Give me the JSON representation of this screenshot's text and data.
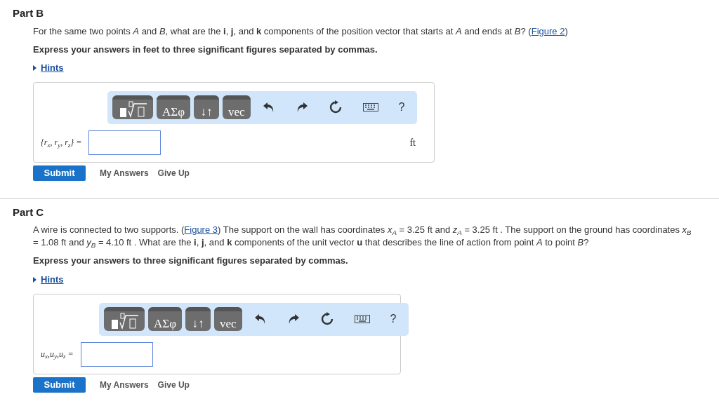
{
  "parts": [
    {
      "title": "Part B",
      "question": [
        {
          "kind": "text",
          "text": "For the same two points *A* and *B*, what are the **i**, **j**, and **k** components of the position vector that starts at *A* and ends at *B*? ("
        },
        {
          "kind": "link",
          "text": "Figure 2"
        },
        {
          "kind": "text",
          "text": ")"
        }
      ],
      "instruction": "Express your answers in feet to three significant figures separated by commas.",
      "hints": "Hints",
      "answer": {
        "label": "{*r*$_{x}$, *r*$_{y}$, *r*$_{z}$} =",
        "unit": "ft",
        "toolbar": [
          {
            "kind": "template"
          },
          {
            "kind": "text",
            "label": "ΑΣφ"
          },
          {
            "kind": "text",
            "label": "↓↑"
          },
          {
            "kind": "text",
            "label": "vec"
          },
          {
            "kind": "undo"
          },
          {
            "kind": "redo"
          },
          {
            "kind": "reset"
          },
          {
            "kind": "keyboard"
          },
          {
            "kind": "help",
            "label": "?"
          }
        ]
      },
      "buttons": [
        {
          "kind": "primary",
          "label": "Submit"
        },
        {
          "kind": "link",
          "label": "My Answers"
        },
        {
          "kind": "link",
          "label": "Give Up"
        }
      ]
    },
    {
      "title": "Part C",
      "question": [
        {
          "kind": "text",
          "text": "A wire is connected to two supports. ("
        },
        {
          "kind": "link",
          "text": "Figure 3"
        },
        {
          "kind": "text",
          "text": ") The support on the wall has coordinates *x*$_{A}$ = 3.25 ft and *z*$_{A}$ = 3.25 ft . The support on the ground has coordinates *x*$_{B}$ = 1.08 ft and *y*$_{B}$ = 4.10 ft . What are the **i**, **j**, and **k** components of the unit vector **u** that describes the line of action from point *A* to point *B*?"
        }
      ],
      "instruction": "Express your answers to three significant figures separated by commas.",
      "hints": "Hints",
      "answer": {
        "label": "*u*$_{x}$,*u*$_{y}$,*u*$_{z}$ =",
        "toolbar": [
          {
            "kind": "template"
          },
          {
            "kind": "text",
            "label": "ΑΣφ"
          },
          {
            "kind": "text",
            "label": "↓↑"
          },
          {
            "kind": "text",
            "label": "vec"
          },
          {
            "kind": "undo"
          },
          {
            "kind": "redo"
          },
          {
            "kind": "reset"
          },
          {
            "kind": "keyboard"
          },
          {
            "kind": "help",
            "label": "?"
          }
        ]
      },
      "buttons": [
        {
          "kind": "primary",
          "label": "Submit"
        },
        {
          "kind": "link",
          "label": "My Answers"
        },
        {
          "kind": "link",
          "label": "Give Up"
        }
      ]
    }
  ]
}
